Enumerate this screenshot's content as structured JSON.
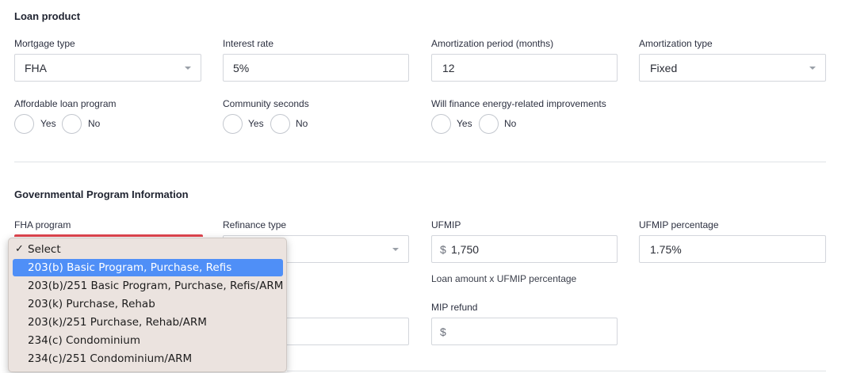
{
  "loan_product": {
    "title": "Loan product",
    "mortgage_type": {
      "label": "Mortgage type",
      "value": "FHA"
    },
    "interest_rate": {
      "label": "Interest rate",
      "value": "5%"
    },
    "amortization_period": {
      "label": "Amortization period (months)",
      "value": "12"
    },
    "amortization_type": {
      "label": "Amortization type",
      "value": "Fixed"
    },
    "affordable": {
      "label": "Affordable loan program",
      "yes": "Yes",
      "no": "No"
    },
    "community": {
      "label": "Community seconds",
      "yes": "Yes",
      "no": "No"
    },
    "energy": {
      "label": "Will finance energy-related improvements",
      "yes": "Yes",
      "no": "No"
    }
  },
  "gov_program": {
    "title": "Governmental Program Information",
    "fha_program": {
      "label": "FHA program"
    },
    "refinance_type": {
      "label": "Refinance type",
      "value": ""
    },
    "ufmip": {
      "label": "UFMIP",
      "prefix": "$",
      "value": "1,750",
      "hint": "Loan amount x UFMIP percentage"
    },
    "ufmip_percentage": {
      "label": "UFMIP percentage",
      "value": "1.75%"
    },
    "mip_refund": {
      "label": "MIP refund",
      "prefix": "$",
      "value": ""
    }
  },
  "fha_dropdown": {
    "checkmark": "✓",
    "options": [
      "Select",
      "203(b) Basic Program, Purchase, Refis",
      "203(b)/251 Basic Program, Purchase, Refis/ARM",
      "203(k) Purchase, Rehab",
      "203(k)/251 Purchase, Rehab/ARM",
      "234(c) Condominium",
      "234(c)/251 Condominium/ARM"
    ],
    "selected_index": 0,
    "highlighted_index": 1
  },
  "colors": {
    "highlight": "#4f8ff7",
    "error": "#e0454e",
    "menu_bg": "#ebe3df"
  }
}
